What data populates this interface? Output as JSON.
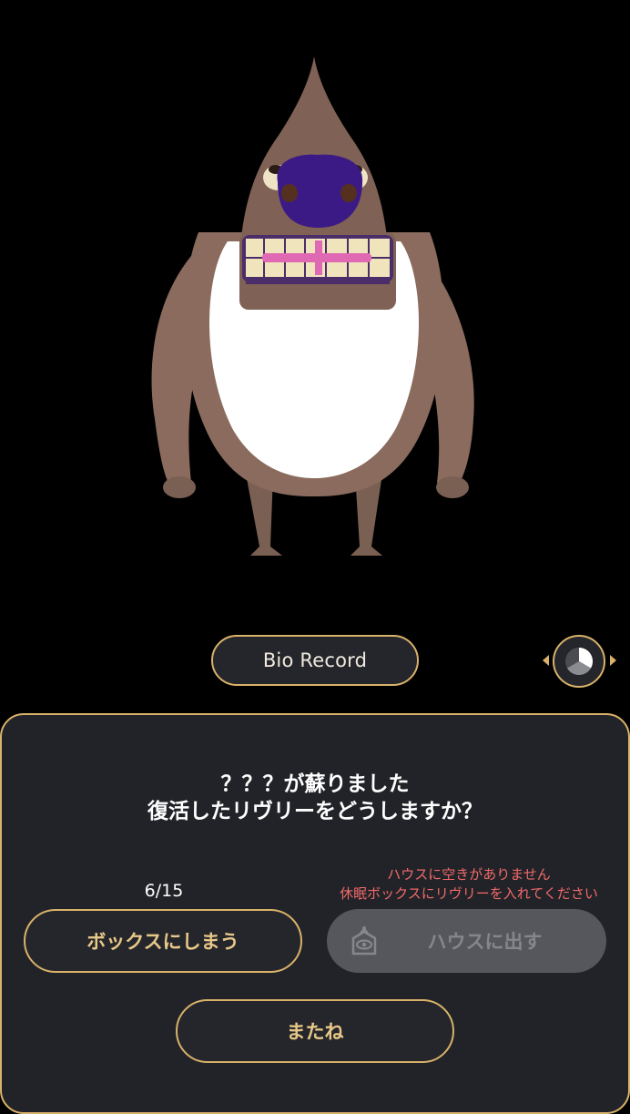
{
  "bio_record_label": "Bio Record",
  "message": {
    "line1": "？？？が蘇りました",
    "line2": "復活したリヴリーをどうしますか？"
  },
  "box_count": "6/15",
  "house_warning": {
    "line1": "ハウスに空きがありません",
    "line2": "休眠ボックスにリヴリーを入れてください"
  },
  "buttons": {
    "box": "ボックスにしまう",
    "house": "ハウスに出す",
    "bye": "またね"
  },
  "colors": {
    "accent": "#d9b26a",
    "warning": "#f06a6a",
    "panel": "#222328",
    "disabled_button": "#55575d"
  },
  "icons": {
    "view_toggle": "camera-view-icon",
    "house": "house-eye-icon"
  }
}
